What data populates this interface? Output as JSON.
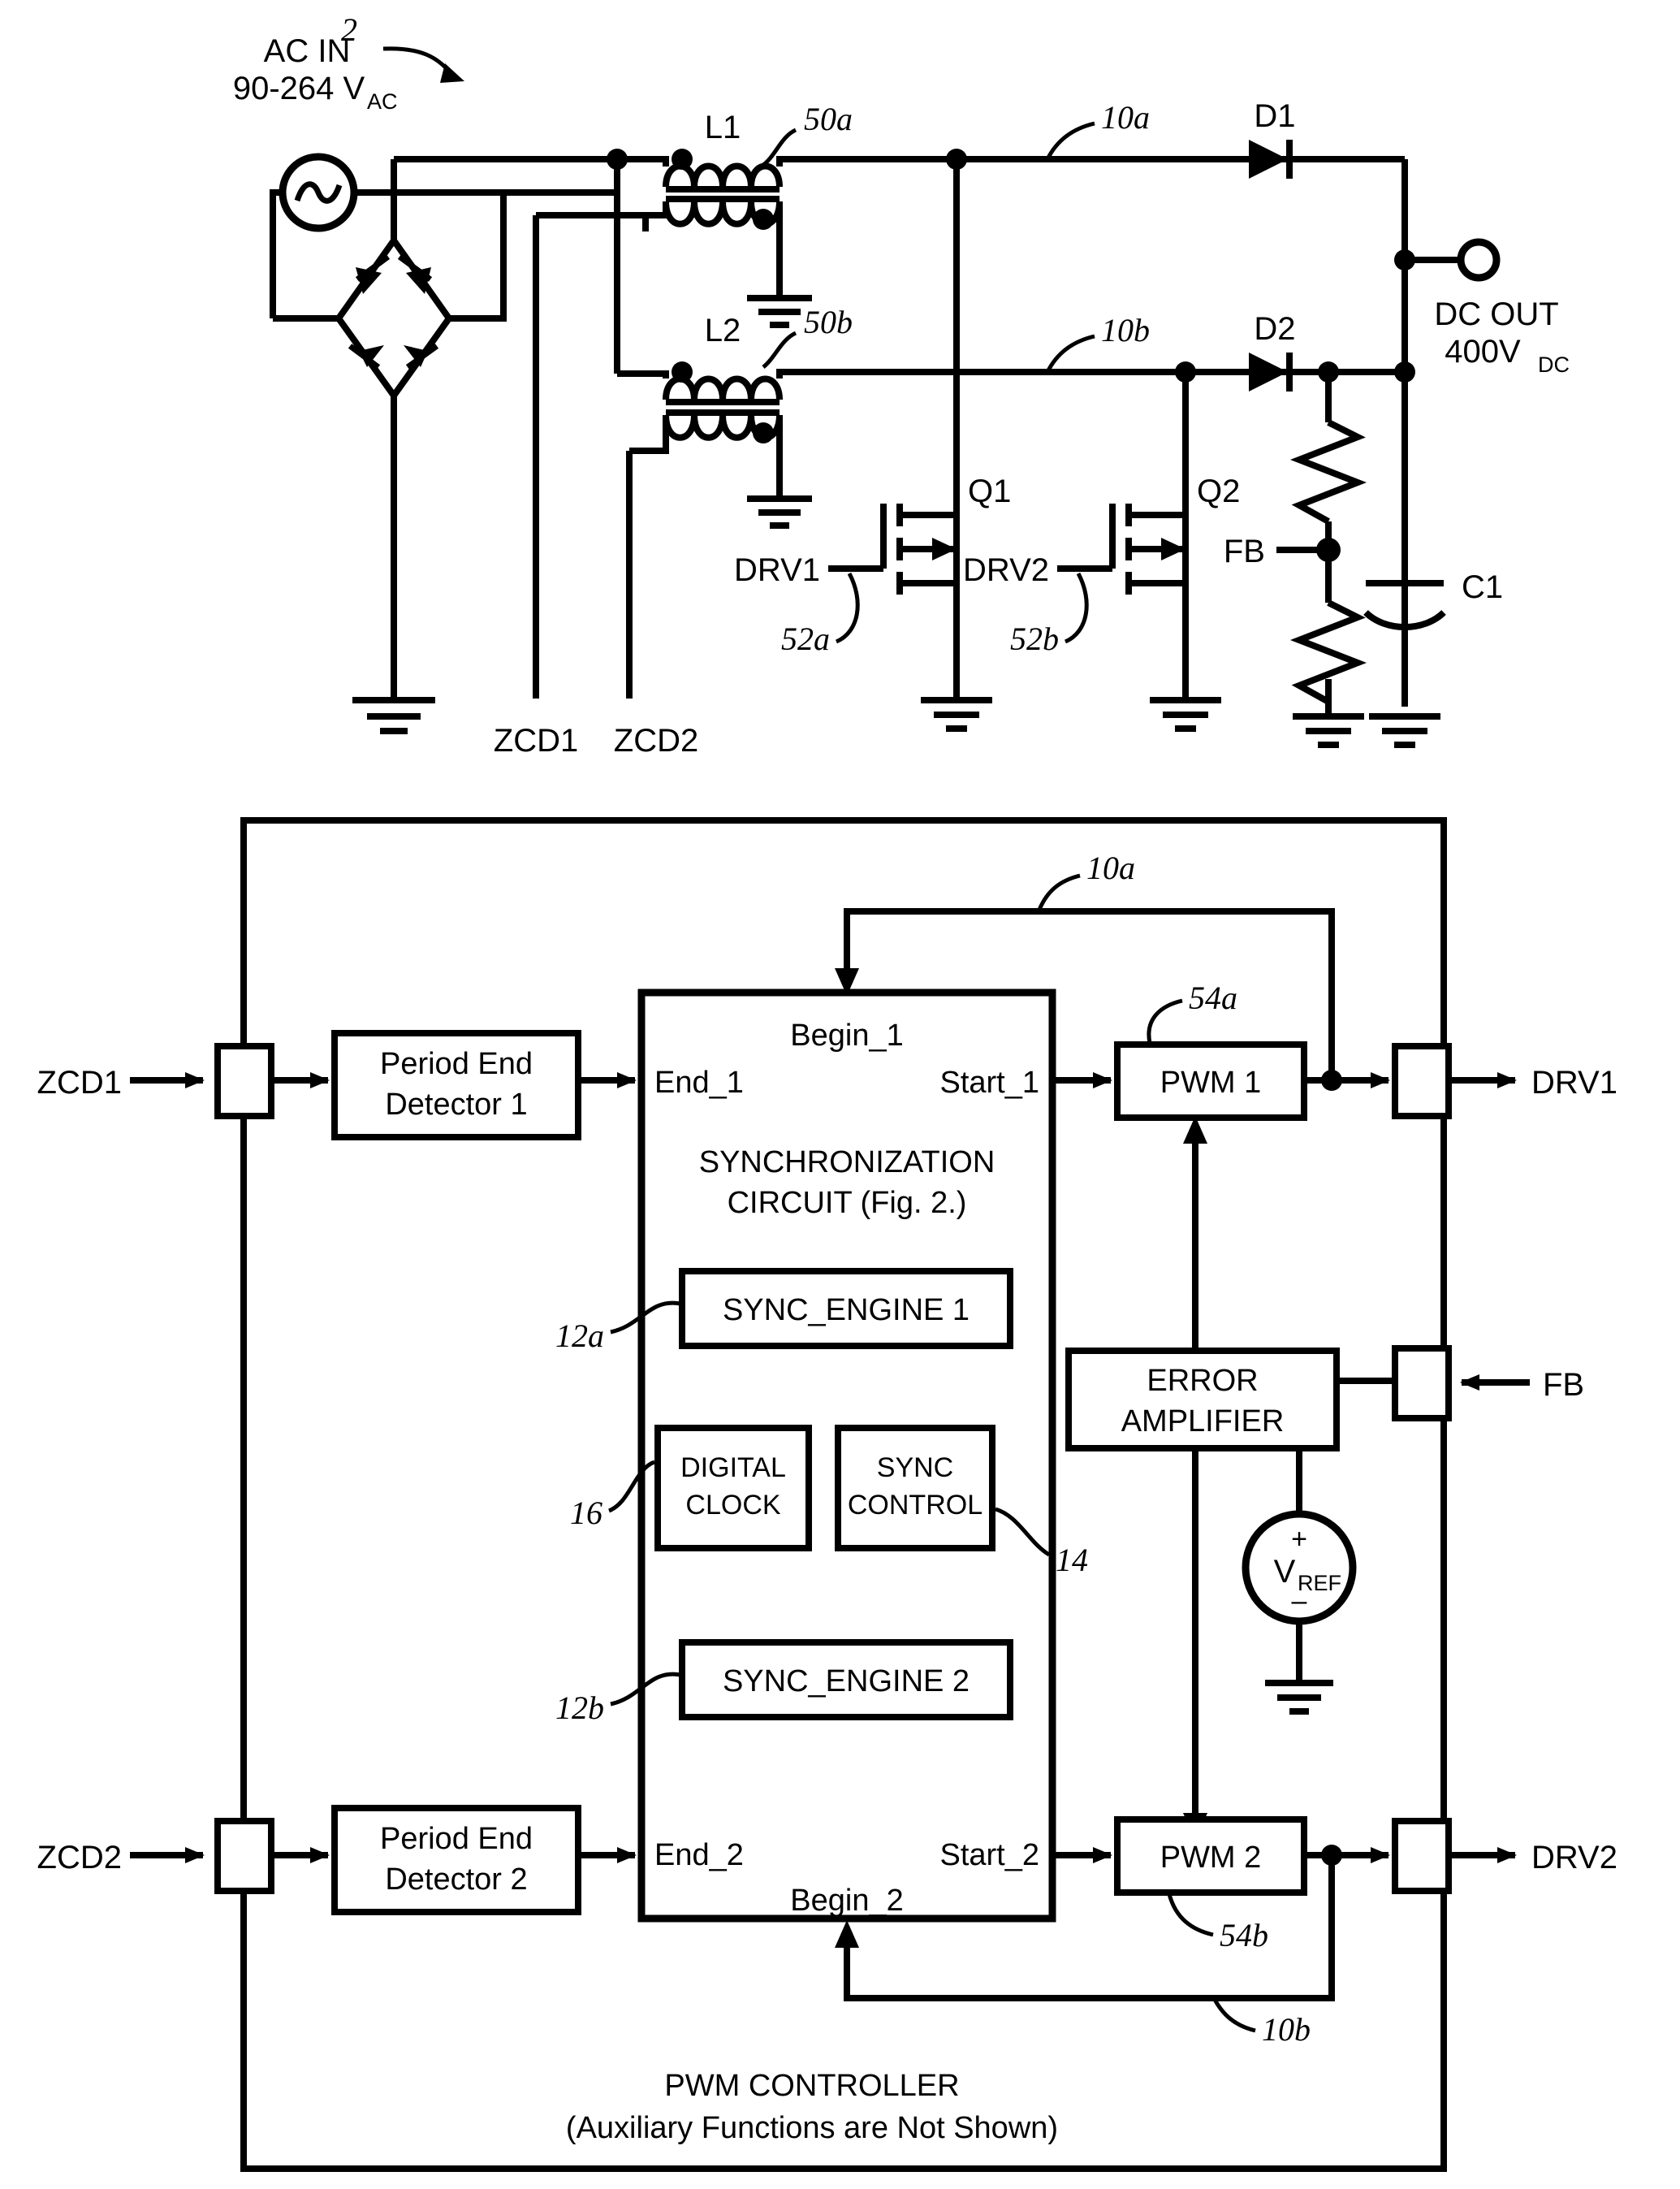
{
  "figure": {
    "reference_numeral": "2"
  },
  "power_stage": {
    "ac_source": {
      "line1": "AC IN",
      "line2_main": "90-264 V",
      "line2_sub": "AC",
      "icon": "ac-source-icon"
    },
    "inductors": [
      {
        "name": "L1",
        "ref": "50a"
      },
      {
        "name": "L2",
        "ref": "50b"
      }
    ],
    "nodes": [
      {
        "label": "10a"
      },
      {
        "label": "10b"
      }
    ],
    "diodes": [
      {
        "name": "D1"
      },
      {
        "name": "D2"
      }
    ],
    "mosfets": [
      {
        "name": "Q1",
        "drive": "DRV1",
        "ref": "52a"
      },
      {
        "name": "Q2",
        "drive": "DRV2",
        "ref": "52b"
      }
    ],
    "feedback": {
      "label": "FB"
    },
    "capacitor": {
      "name": "C1"
    },
    "output": {
      "line1": "DC OUT",
      "line2_main": "400V",
      "line2_sub": "DC"
    },
    "zcd": [
      {
        "label": "ZCD1"
      },
      {
        "label": "ZCD2"
      }
    ]
  },
  "controller": {
    "caption_line1": "PWM CONTROLLER",
    "caption_line2": "(Auxiliary Functions are Not Shown)",
    "pins": {
      "zcd1": "ZCD1",
      "zcd2": "ZCD2",
      "drv1": "DRV1",
      "drv2": "DRV2",
      "fb": "FB"
    },
    "detectors": [
      {
        "line1": "Period End",
        "line2": "Detector 1"
      },
      {
        "line1": "Period End",
        "line2": "Detector 2"
      }
    ],
    "sync_circuit": {
      "title_line1": "SYNCHRONIZATION",
      "title_line2": "CIRCUIT (Fig. 2.)",
      "ports": {
        "end_1": "End_1",
        "begin_1": "Begin_1",
        "start_1": "Start_1",
        "end_2": "End_2",
        "begin_2": "Begin_2",
        "start_2": "Start_2"
      },
      "sub_blocks": [
        {
          "label": "SYNC_ENGINE 1",
          "ref": "12a"
        },
        {
          "label_line1": "DIGITAL",
          "label_line2": "CLOCK",
          "ref": "16"
        },
        {
          "label_line1": "SYNC",
          "label_line2": "CONTROL",
          "ref": "14"
        },
        {
          "label": "SYNC_ENGINE 2",
          "ref": "12b"
        }
      ]
    },
    "pwm_blocks": [
      {
        "label": "PWM 1",
        "ref": "54a"
      },
      {
        "label": "PWM 2",
        "ref": "54b"
      }
    ],
    "error_amplifier": {
      "line1": "ERROR",
      "line2": "AMPLIFIER"
    },
    "vref": {
      "main": "V",
      "sub": "REF",
      "plus": "+",
      "minus": "–"
    },
    "feedback_paths": [
      {
        "label": "10a"
      },
      {
        "label": "10b"
      }
    ]
  },
  "colors": {
    "line": "#000000",
    "background": "#ffffff"
  }
}
